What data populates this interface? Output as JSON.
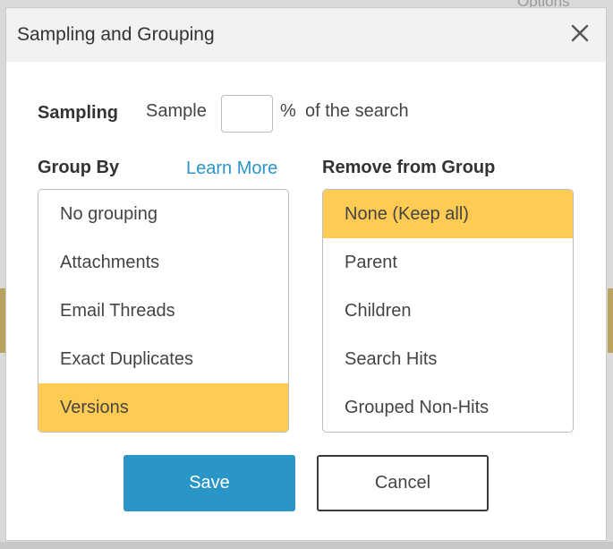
{
  "background": {
    "partial_label": "Options"
  },
  "dialog": {
    "title": "Sampling and Grouping",
    "close_icon": "close-icon"
  },
  "sampling": {
    "label": "Sampling",
    "sample_word": "Sample",
    "input_value": "",
    "percent": "%",
    "suffix": "of the search"
  },
  "group_by": {
    "label": "Group By",
    "learn_more": "Learn More",
    "items": [
      {
        "label": "No grouping",
        "selected": false
      },
      {
        "label": "Attachments",
        "selected": false
      },
      {
        "label": "Email Threads",
        "selected": false
      },
      {
        "label": "Exact Duplicates",
        "selected": false
      },
      {
        "label": "Versions",
        "selected": true
      }
    ]
  },
  "remove_from_group": {
    "label": "Remove from Group",
    "items": [
      {
        "label": "None (Keep all)",
        "selected": true
      },
      {
        "label": "Parent",
        "selected": false
      },
      {
        "label": "Children",
        "selected": false
      },
      {
        "label": "Search Hits",
        "selected": false
      },
      {
        "label": "Grouped Non-Hits",
        "selected": false
      }
    ]
  },
  "buttons": {
    "save": "Save",
    "cancel": "Cancel"
  },
  "colors": {
    "accent": "#2a96c8",
    "selected": "#ffcb52"
  }
}
